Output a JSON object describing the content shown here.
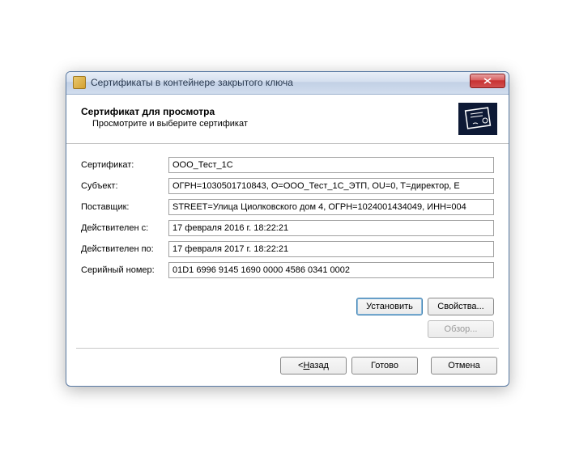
{
  "window": {
    "title": "Сертификаты в контейнере закрытого ключа"
  },
  "header": {
    "title": "Сертификат для просмотра",
    "subtitle": "Просмотрите и выберите сертификат"
  },
  "fields": {
    "certificate": {
      "label": "Сертификат:",
      "value": "ООО_Тест_1С"
    },
    "subject": {
      "label": "Субъект:",
      "value": "ОГРН=1030501710843, O=ООО_Тест_1С_ЭТП, OU=0, T=директор, E"
    },
    "issuer": {
      "label": "Поставщик:",
      "value": "STREET=Улица Циолковского дом 4, ОГРН=1024001434049, ИНН=004"
    },
    "valid_from": {
      "label": "Действителен с:",
      "value": "17 февраля 2016 г. 18:22:21"
    },
    "valid_to": {
      "label": "Действителен по:",
      "value": "17 февраля 2017 г. 18:22:21"
    },
    "serial": {
      "label": "Серийный номер:",
      "value": "01D1 6996 9145 1690 0000 4586 0341 0002"
    }
  },
  "buttons": {
    "install": "Установить",
    "properties": "Свойства...",
    "browse": "Обзор...",
    "back_prefix": "< ",
    "back_key": "Н",
    "back_suffix": "азад",
    "finish": "Готово",
    "cancel": "Отмена"
  }
}
